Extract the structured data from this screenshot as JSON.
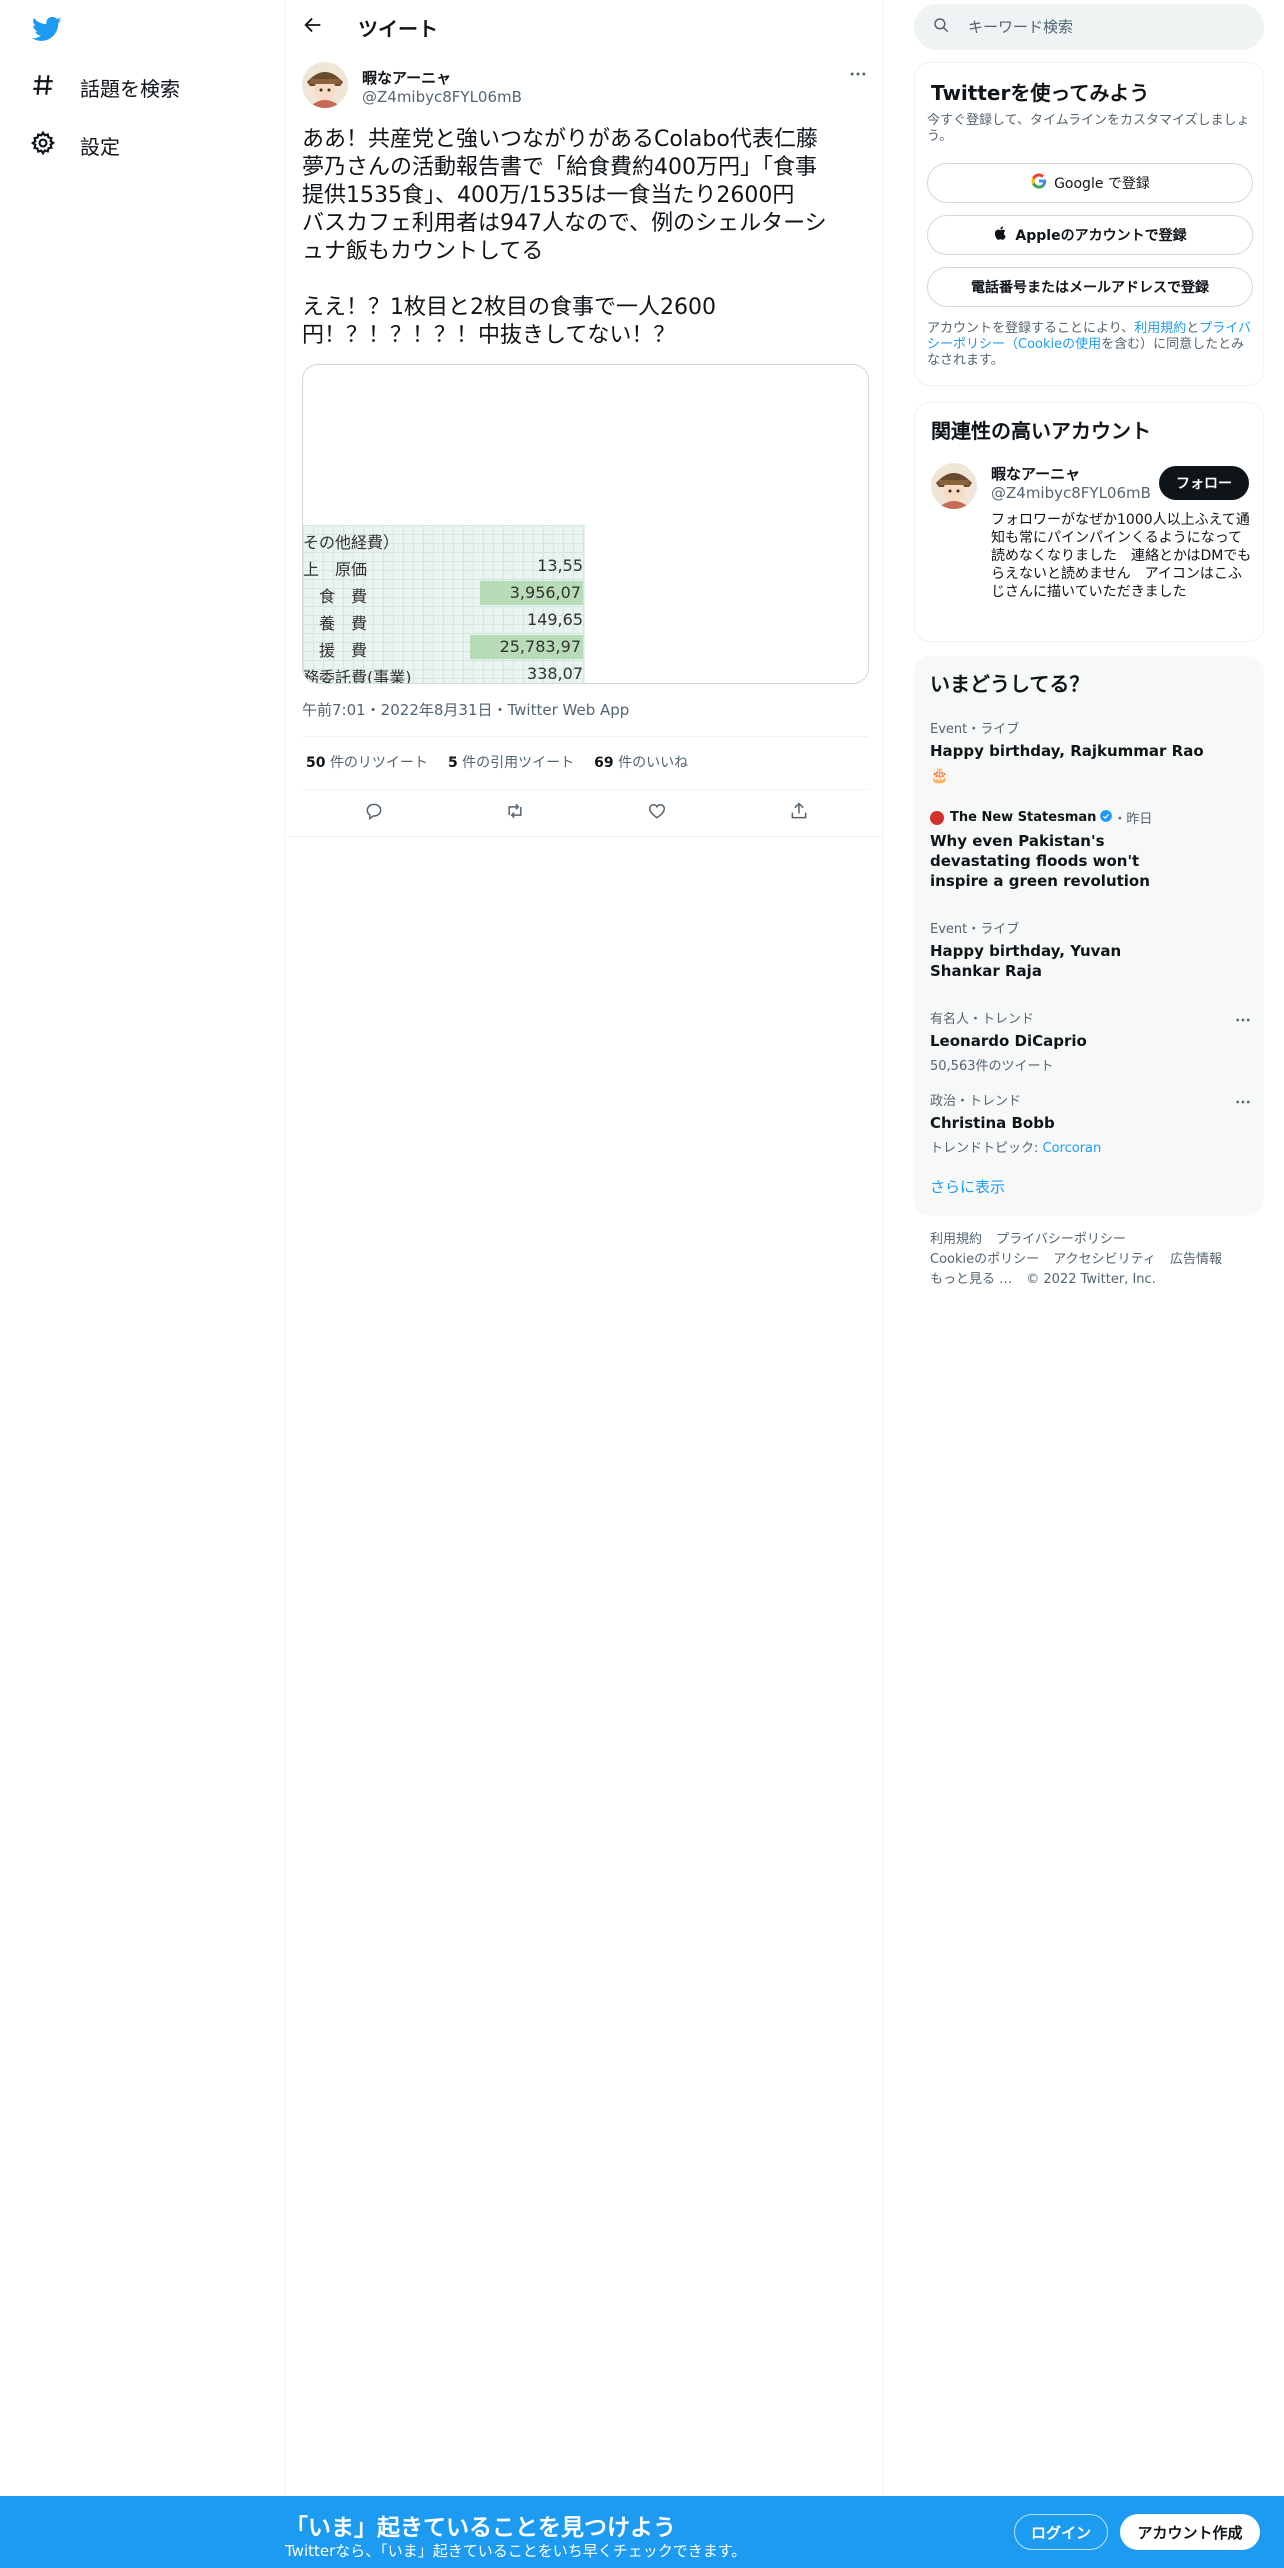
{
  "nav": {
    "items": [
      {
        "label": "話題を検索",
        "icon": "hashtag-icon"
      },
      {
        "label": "設定",
        "icon": "gear-icon"
      }
    ]
  },
  "header": {
    "title": "ツイート"
  },
  "tweet": {
    "author_name": "暇なアーニャ",
    "author_handle": "@Z4mibyc8FYL06mB",
    "text": "ああ！共産党と強いつながりがあるColabo代表仁藤\n夢乃さんの活動報告書で「給食費約400万円」「食事\n提供1535食」、400万/1535は一食当たり2600円\nバスカフェ利用者は947人なので、例のシェルターシ\nュナ飯もカウントしてる\n\nええ！？1枚目と2枚目の食事で一人2600\n円！？！？！？！中抜きしてない！？",
    "media_rows": [
      {
        "label": "その他経費）",
        "value": "",
        "highlight": false
      },
      {
        "label": "上　原価",
        "value": "13,55",
        "highlight": false
      },
      {
        "label": "　食　費",
        "value": "3,956,07",
        "highlight": true
      },
      {
        "label": "　養　費",
        "value": "149,65",
        "highlight": false
      },
      {
        "label": "　援　費",
        "value": "25,783,97",
        "highlight": true
      },
      {
        "label": "務委託費(事業)",
        "value": "338,07",
        "highlight": false
      }
    ],
    "meta": "午前7:01・2022年8月31日・Twitter Web App",
    "retweets": "50",
    "retweets_label": "件のリツイート",
    "quotes": "5",
    "quotes_label": "件の引用ツイート",
    "likes": "69",
    "likes_label": "件のいいね"
  },
  "search": {
    "placeholder": "キーワード検索"
  },
  "signup_card": {
    "title": "Twitterを使ってみよう",
    "subtitle": "今すぐ登録して、タイムラインをカスタマイズしましょう。",
    "google_label": "Google で登録",
    "apple_label": "Appleのアカウントで登録",
    "phone_label": "電話番号またはメールアドレスで登録",
    "terms_prefix": "アカウントを登録することにより、",
    "terms_link": "利用規約",
    "terms_and": "と",
    "privacy_link": "プライバシーポリシー（Cookieの使用",
    "terms_suffix": "を含む）に同意したとみなされます。"
  },
  "related": {
    "title": "関連性の高いアカウント",
    "name": "暇なアーニャ",
    "handle": "@Z4mibyc8FYL06mB",
    "follow_label": "フォロー",
    "bio": "フォロワーがなぜか1000人以上ふえて通知も常にパインパインくるようになって読めなくなりました　連絡とかはDMでもらえないと読めません　アイコンはこふじさんに描いていただきました"
  },
  "trends": {
    "title": "いまどうしてる？",
    "items": [
      {
        "context": "Event・ライブ",
        "title": "Happy birthday, Rajkummar Rao",
        "extra": "🎂",
        "sub": ""
      },
      {
        "context": "The New Statesman",
        "context_suffix": "・昨日",
        "title": "Why even Pakistan's devastating floods won't inspire a green revolution",
        "sub": ""
      },
      {
        "context": "Event・ライブ",
        "title": "Happy birthday, Yuvan Shankar Raja",
        "sub": ""
      },
      {
        "context": "有名人・トレンド",
        "title": "Leonardo DiCaprio",
        "sub": "50,563件のツイート"
      },
      {
        "context": "政治・トレンド",
        "title": "Christina Bobb",
        "sub_prefix": "トレンドトピック: ",
        "sub_link": "Corcoran"
      }
    ],
    "show_more": "さらに表示"
  },
  "footer": {
    "links": [
      "利用規約",
      "プライバシーポリシー",
      "Cookieのポリシー",
      "アクセシビリティ",
      "広告情報",
      "もっと見る …",
      "© 2022 Twitter, Inc."
    ]
  },
  "bottom_bar": {
    "title": "「いま」起きていることを見つけよう",
    "subtitle": "Twitterなら、「いま」起きていることをいち早くチェックできます。",
    "login_label": "ログイン",
    "signup_label": "アカウント作成"
  },
  "colors": {
    "accent": "#1d9bf0",
    "text": "#0f1419",
    "muted": "#536471"
  }
}
